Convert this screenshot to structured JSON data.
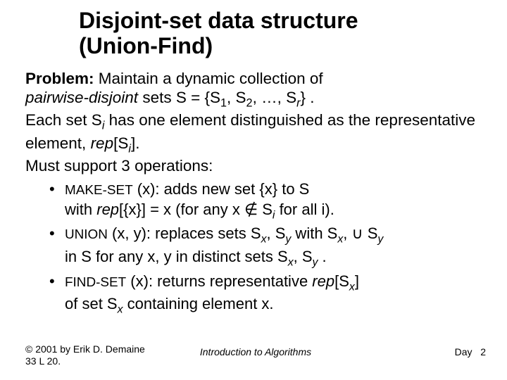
{
  "title_l1": "Disjoint-set data structure",
  "title_l2": "(Union-Find)",
  "problem_label": "Problem:",
  "problem_rest": " Maintain a dynamic collection of ",
  "pairwise": "pairwise-disjoint",
  "sets_eq": " sets S = {S",
  "s1sub": "1",
  "comma1": ", S",
  "s2sub": "2",
  "dots": ", …, S",
  "srsub": "r",
  "close_brace": "} .",
  "each_set": "Each set S",
  "sub_i1": "i",
  "each_set_rest": " has one element distinguished as the representative element, ",
  "rep_open": "rep",
  "rep_brack": "[S",
  "sub_i2": "i",
  "rep_close": "].",
  "must_support": "Must support 3 operations:",
  "makeset_op": "MAKE-SET",
  "makeset_arg": " (x)",
  "makeset_desc1": ": adds new set {x} to S",
  "makeset_desc2a": "with ",
  "makeset_rep": "rep",
  "makeset_desc2b": "[{x}] = x (for any x ∉ S",
  "sub_i3": "i",
  "makeset_desc2c": " for all i).",
  "union_op": "UNION",
  "union_arg": " (x, y)",
  "union_desc1a": ": replaces sets S",
  "sub_x1": "x",
  "union_comma": ", S",
  "sub_y1": "y",
  "union_with": " with S",
  "sub_x2": "x",
  "union_comma2": ", ∪ S",
  "sub_y2": "y",
  "union_desc2a": "in S for any x, y in distinct sets S",
  "sub_x3": "x",
  "union_comma3": ", S",
  "sub_y3": "y",
  "union_period": " .",
  "findset_op": "FIND-SET",
  "findset_arg": " (x)",
  "findset_desc1": ": returns representative ",
  "findset_rep": "rep",
  "findset_brack": "[S",
  "sub_x4": "x",
  "findset_close": "]",
  "findset_desc2a": "of set S",
  "sub_x5": "x",
  "findset_desc2b": " containing element x.",
  "footer_left1": "© 2001 by Erik D. Demaine",
  "footer_left2": "33    L 20.",
  "footer_center": "Introduction to Algorithms",
  "footer_right_label": "Day",
  "footer_right_num": "2"
}
